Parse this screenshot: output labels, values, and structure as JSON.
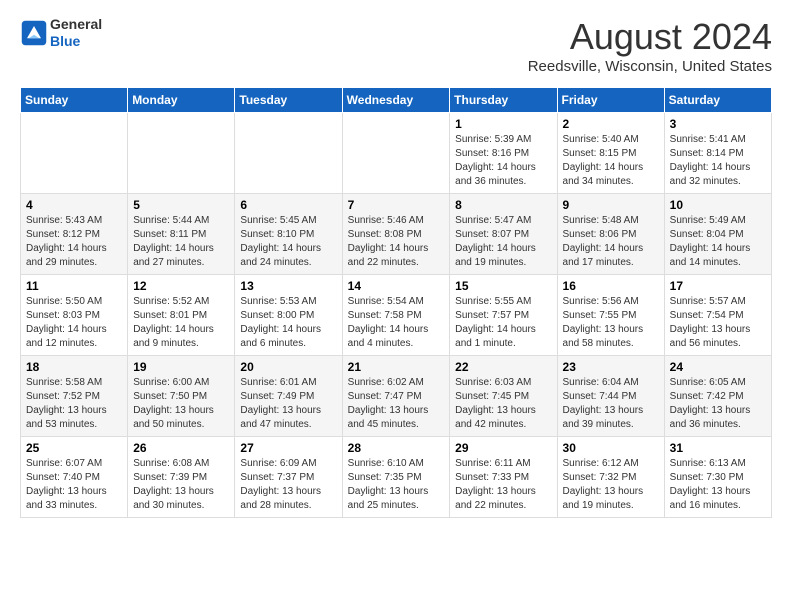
{
  "header": {
    "logo": {
      "line1": "General",
      "line2": "Blue"
    },
    "title": "August 2024",
    "location": "Reedsville, Wisconsin, United States"
  },
  "days_of_week": [
    "Sunday",
    "Monday",
    "Tuesday",
    "Wednesday",
    "Thursday",
    "Friday",
    "Saturday"
  ],
  "weeks": [
    [
      {
        "day": "",
        "info": ""
      },
      {
        "day": "",
        "info": ""
      },
      {
        "day": "",
        "info": ""
      },
      {
        "day": "",
        "info": ""
      },
      {
        "day": "1",
        "info": "Sunrise: 5:39 AM\nSunset: 8:16 PM\nDaylight: 14 hours\nand 36 minutes."
      },
      {
        "day": "2",
        "info": "Sunrise: 5:40 AM\nSunset: 8:15 PM\nDaylight: 14 hours\nand 34 minutes."
      },
      {
        "day": "3",
        "info": "Sunrise: 5:41 AM\nSunset: 8:14 PM\nDaylight: 14 hours\nand 32 minutes."
      }
    ],
    [
      {
        "day": "4",
        "info": "Sunrise: 5:43 AM\nSunset: 8:12 PM\nDaylight: 14 hours\nand 29 minutes."
      },
      {
        "day": "5",
        "info": "Sunrise: 5:44 AM\nSunset: 8:11 PM\nDaylight: 14 hours\nand 27 minutes."
      },
      {
        "day": "6",
        "info": "Sunrise: 5:45 AM\nSunset: 8:10 PM\nDaylight: 14 hours\nand 24 minutes."
      },
      {
        "day": "7",
        "info": "Sunrise: 5:46 AM\nSunset: 8:08 PM\nDaylight: 14 hours\nand 22 minutes."
      },
      {
        "day": "8",
        "info": "Sunrise: 5:47 AM\nSunset: 8:07 PM\nDaylight: 14 hours\nand 19 minutes."
      },
      {
        "day": "9",
        "info": "Sunrise: 5:48 AM\nSunset: 8:06 PM\nDaylight: 14 hours\nand 17 minutes."
      },
      {
        "day": "10",
        "info": "Sunrise: 5:49 AM\nSunset: 8:04 PM\nDaylight: 14 hours\nand 14 minutes."
      }
    ],
    [
      {
        "day": "11",
        "info": "Sunrise: 5:50 AM\nSunset: 8:03 PM\nDaylight: 14 hours\nand 12 minutes."
      },
      {
        "day": "12",
        "info": "Sunrise: 5:52 AM\nSunset: 8:01 PM\nDaylight: 14 hours\nand 9 minutes."
      },
      {
        "day": "13",
        "info": "Sunrise: 5:53 AM\nSunset: 8:00 PM\nDaylight: 14 hours\nand 6 minutes."
      },
      {
        "day": "14",
        "info": "Sunrise: 5:54 AM\nSunset: 7:58 PM\nDaylight: 14 hours\nand 4 minutes."
      },
      {
        "day": "15",
        "info": "Sunrise: 5:55 AM\nSunset: 7:57 PM\nDaylight: 14 hours\nand 1 minute."
      },
      {
        "day": "16",
        "info": "Sunrise: 5:56 AM\nSunset: 7:55 PM\nDaylight: 13 hours\nand 58 minutes."
      },
      {
        "day": "17",
        "info": "Sunrise: 5:57 AM\nSunset: 7:54 PM\nDaylight: 13 hours\nand 56 minutes."
      }
    ],
    [
      {
        "day": "18",
        "info": "Sunrise: 5:58 AM\nSunset: 7:52 PM\nDaylight: 13 hours\nand 53 minutes."
      },
      {
        "day": "19",
        "info": "Sunrise: 6:00 AM\nSunset: 7:50 PM\nDaylight: 13 hours\nand 50 minutes."
      },
      {
        "day": "20",
        "info": "Sunrise: 6:01 AM\nSunset: 7:49 PM\nDaylight: 13 hours\nand 47 minutes."
      },
      {
        "day": "21",
        "info": "Sunrise: 6:02 AM\nSunset: 7:47 PM\nDaylight: 13 hours\nand 45 minutes."
      },
      {
        "day": "22",
        "info": "Sunrise: 6:03 AM\nSunset: 7:45 PM\nDaylight: 13 hours\nand 42 minutes."
      },
      {
        "day": "23",
        "info": "Sunrise: 6:04 AM\nSunset: 7:44 PM\nDaylight: 13 hours\nand 39 minutes."
      },
      {
        "day": "24",
        "info": "Sunrise: 6:05 AM\nSunset: 7:42 PM\nDaylight: 13 hours\nand 36 minutes."
      }
    ],
    [
      {
        "day": "25",
        "info": "Sunrise: 6:07 AM\nSunset: 7:40 PM\nDaylight: 13 hours\nand 33 minutes."
      },
      {
        "day": "26",
        "info": "Sunrise: 6:08 AM\nSunset: 7:39 PM\nDaylight: 13 hours\nand 30 minutes."
      },
      {
        "day": "27",
        "info": "Sunrise: 6:09 AM\nSunset: 7:37 PM\nDaylight: 13 hours\nand 28 minutes."
      },
      {
        "day": "28",
        "info": "Sunrise: 6:10 AM\nSunset: 7:35 PM\nDaylight: 13 hours\nand 25 minutes."
      },
      {
        "day": "29",
        "info": "Sunrise: 6:11 AM\nSunset: 7:33 PM\nDaylight: 13 hours\nand 22 minutes."
      },
      {
        "day": "30",
        "info": "Sunrise: 6:12 AM\nSunset: 7:32 PM\nDaylight: 13 hours\nand 19 minutes."
      },
      {
        "day": "31",
        "info": "Sunrise: 6:13 AM\nSunset: 7:30 PM\nDaylight: 13 hours\nand 16 minutes."
      }
    ]
  ]
}
